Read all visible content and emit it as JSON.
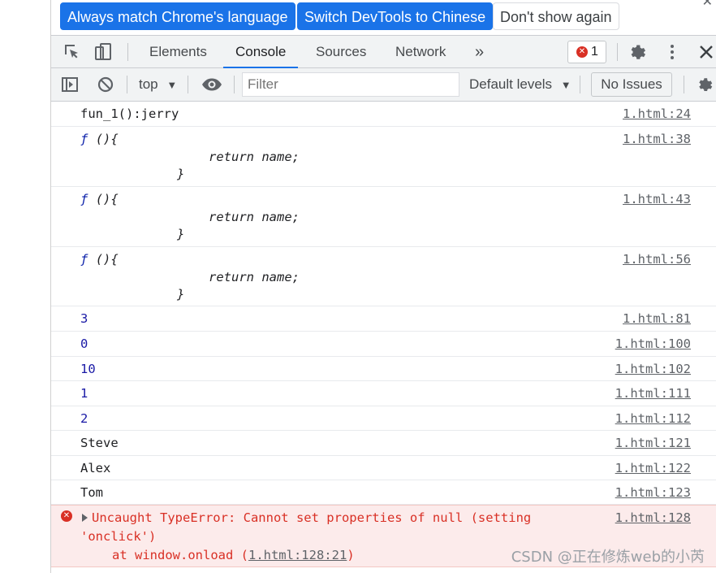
{
  "infobar": {
    "always_match": "Always match Chrome's language",
    "switch_chinese": "Switch DevTools to Chinese",
    "dont_show": "Don't show again"
  },
  "tabs": [
    {
      "label": "Elements"
    },
    {
      "label": "Console"
    },
    {
      "label": "Sources"
    },
    {
      "label": "Network"
    }
  ],
  "more_tabs": "»",
  "error_count": "1",
  "console_toolbar": {
    "context": "top",
    "filter_placeholder": "Filter",
    "levels": "Default levels",
    "issues": "No Issues"
  },
  "messages": [
    {
      "text": "fun_1():jerry",
      "src": "1.html:24"
    },
    {
      "fn_head": "(){",
      "fn_body": "return name;",
      "fn_close": "}",
      "src": "1.html:38"
    },
    {
      "fn_head": "(){",
      "fn_body": "return name;",
      "fn_close": "}",
      "src": "1.html:43"
    },
    {
      "fn_head": "(){",
      "fn_body": "return name;",
      "fn_close": "}",
      "src": "1.html:56"
    },
    {
      "text": "3",
      "src": "1.html:81"
    },
    {
      "text": "0",
      "src": "1.html:100"
    },
    {
      "text": "10",
      "src": "1.html:102"
    },
    {
      "text": "1",
      "src": "1.html:111"
    },
    {
      "text": "2",
      "src": "1.html:112"
    },
    {
      "text": "Steve",
      "src": "1.html:121"
    },
    {
      "text": "Alex",
      "src": "1.html:122"
    },
    {
      "text": "Tom",
      "src": "1.html:123"
    }
  ],
  "error": {
    "line1": "Uncaught TypeError: Cannot set properties of null (setting",
    "line2": "'onclick')",
    "line3_prefix": "at window.onload (",
    "line3_link": "1.html:128:21",
    "line3_suffix": ")",
    "src": "1.html:128"
  },
  "watermark": "CSDN @正在修炼web的小芮",
  "colors": {
    "accent": "#1a73e8",
    "error": "#d93025",
    "number": "#1a1aa6"
  }
}
